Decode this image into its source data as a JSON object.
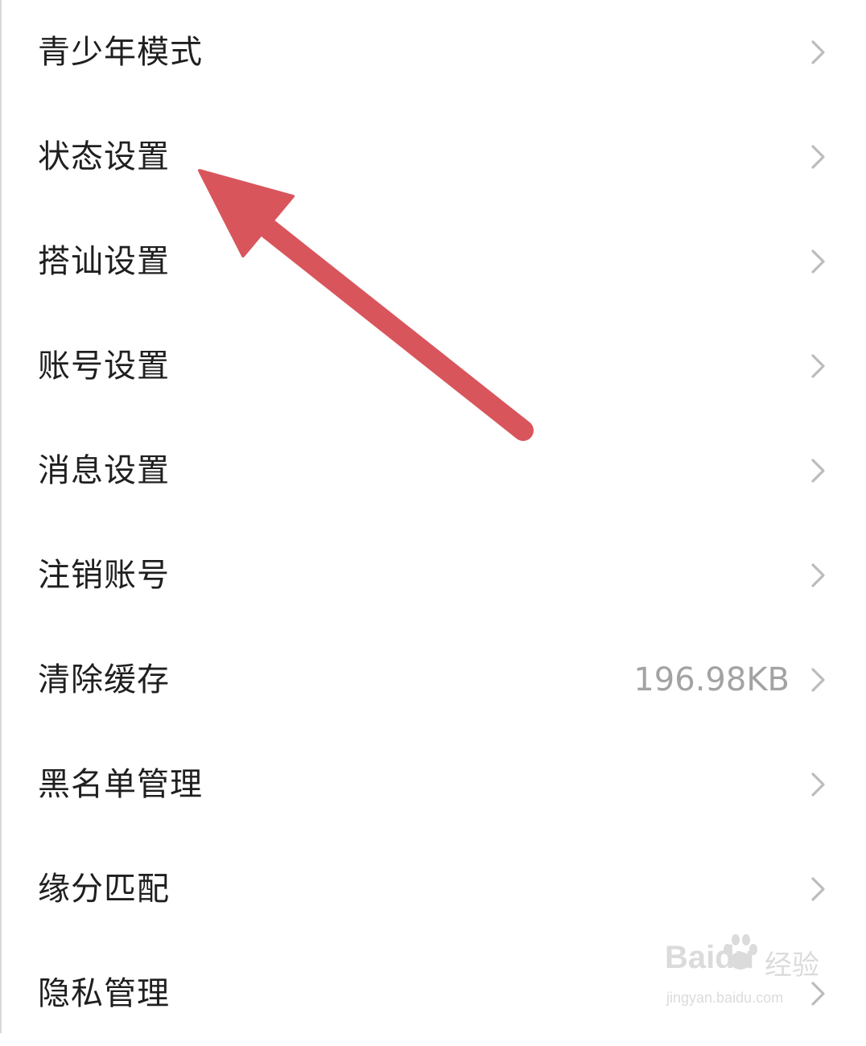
{
  "settings": {
    "items": [
      {
        "label": "青少年模式",
        "value": ""
      },
      {
        "label": "状态设置",
        "value": ""
      },
      {
        "label": "搭讪设置",
        "value": ""
      },
      {
        "label": "账号设置",
        "value": ""
      },
      {
        "label": "消息设置",
        "value": ""
      },
      {
        "label": "注销账号",
        "value": ""
      },
      {
        "label": "清除缓存",
        "value": "196.98KB"
      },
      {
        "label": "黑名单管理",
        "value": ""
      },
      {
        "label": "缘分匹配",
        "value": ""
      },
      {
        "label": "隐私管理",
        "value": ""
      }
    ]
  },
  "annotation": {
    "arrow_color": "#d9555c",
    "points_to": "状态设置"
  },
  "watermark": {
    "brand": "Baidu",
    "product": "经验",
    "url": "jingyan.baidu.com"
  },
  "colors": {
    "text": "#1f1f1f",
    "secondary_text": "#a3a3a3",
    "chevron": "#bcbcbc",
    "background": "#ffffff"
  },
  "icons": {
    "row_chevron": "chevron-right-icon",
    "watermark_logo": "baidu-paw-icon"
  }
}
